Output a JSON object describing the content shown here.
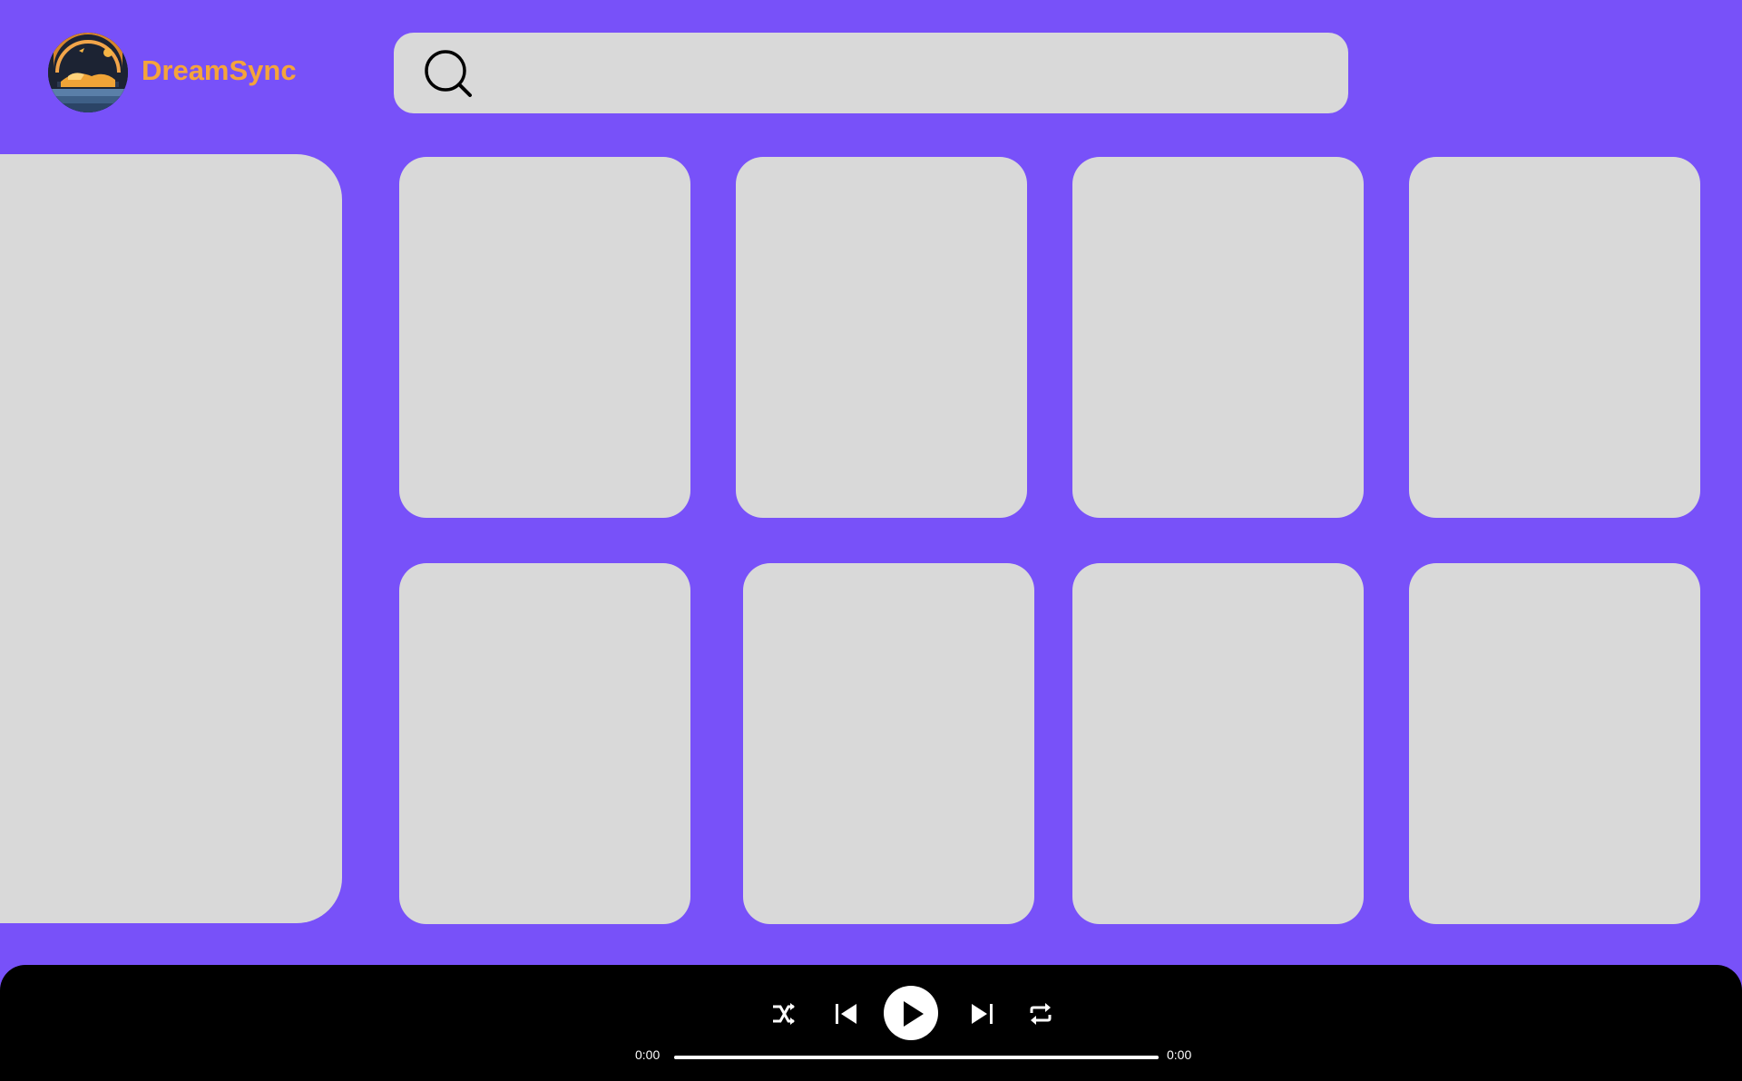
{
  "header": {
    "brand": "DreamSync",
    "search": {
      "placeholder": "",
      "value": ""
    }
  },
  "grid": {
    "cards": [
      {
        "row": 1,
        "col": 1
      },
      {
        "row": 1,
        "col": 2
      },
      {
        "row": 1,
        "col": 3
      },
      {
        "row": 1,
        "col": 4
      },
      {
        "row": 2,
        "col": 1
      },
      {
        "row": 2,
        "col": 2
      },
      {
        "row": 2,
        "col": 3
      },
      {
        "row": 2,
        "col": 4
      }
    ]
  },
  "player": {
    "current_time": "0:00",
    "total_time": "0:00",
    "progress": 1.0,
    "controls": [
      "shuffle-icon",
      "previous-icon",
      "play-icon",
      "next-icon",
      "repeat-icon"
    ]
  },
  "colors": {
    "background": "#7851f9",
    "brand": "#f5a43a",
    "placeholder": "#d9d9d9",
    "player_bar": "#000000"
  }
}
